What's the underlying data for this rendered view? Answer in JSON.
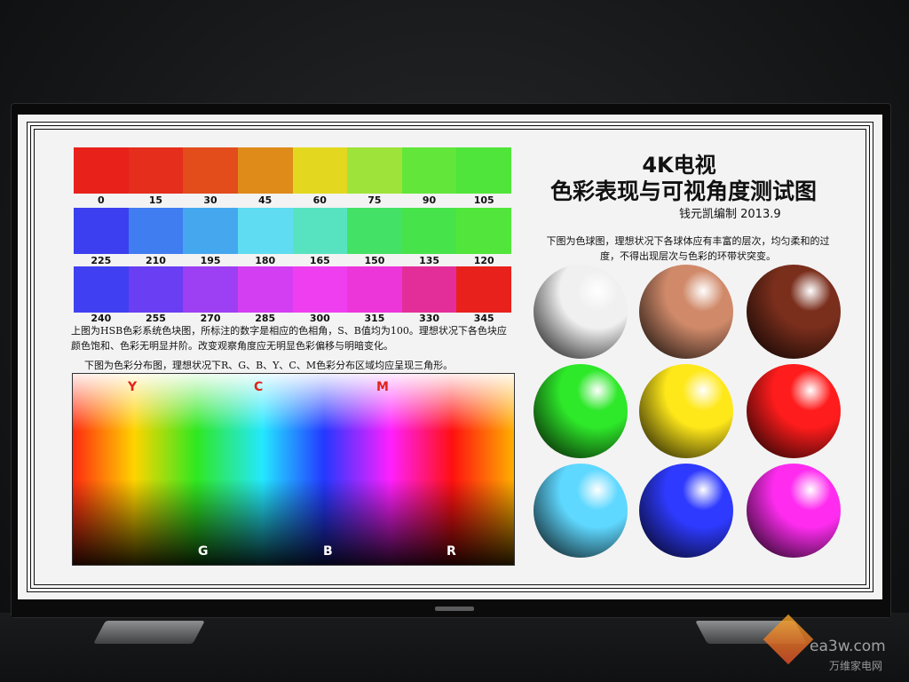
{
  "title_line1": "4K电视",
  "title_line2": "色彩表现与可视角度测试图",
  "author": "钱元凯编制 2013.9",
  "sphere_desc": "下图为色球图，理想状况下各球体应有丰富的层次，均匀柔和的过度，不得出现层次与色彩的环带状突变。",
  "hsb_desc": "上图为HSB色彩系统色块图，所标注的数字是相应的色相角，S、B值均为100。理想状况下各色块应颜色饱和、色彩无明显并阶。改变观察角度应无明显色彩偏移与明暗变化。",
  "dist_desc": "下图为色彩分布图，理想状况下R、G、B、Y、C、M色彩分布区域均应呈现三角形。",
  "row1": {
    "labels": [
      "0",
      "15",
      "30",
      "45",
      "60",
      "75",
      "90",
      "105"
    ],
    "colors": [
      "#e8211a",
      "#e52e1c",
      "#e24d1b",
      "#de8b1a",
      "#e3d81f",
      "#9ee33a",
      "#62e63a",
      "#4fe53a"
    ]
  },
  "row2": {
    "labels": [
      "225",
      "210",
      "195",
      "180",
      "165",
      "150",
      "135",
      "120"
    ],
    "colors": [
      "#3b3ff0",
      "#3f7df1",
      "#45a8ee",
      "#5fdcf1",
      "#58e3c0",
      "#43e266",
      "#47e34a",
      "#52e53c"
    ]
  },
  "row3": {
    "labels": [
      "240",
      "255",
      "270",
      "285",
      "300",
      "315",
      "330",
      "345"
    ],
    "colors": [
      "#4040f2",
      "#6a3ef2",
      "#9d3ff2",
      "#d43ef2",
      "#ef3ef0",
      "#ed36da",
      "#e32e9a",
      "#e8211d"
    ]
  },
  "dist_top_labels": [
    "Y",
    "C",
    "M"
  ],
  "dist_bottom_labels": [
    "G",
    "B",
    "R"
  ],
  "spheres": [
    {
      "name": "gray",
      "color": "#f0f0f0"
    },
    {
      "name": "brown-light",
      "color": "#d08a6a"
    },
    {
      "name": "brown-dark",
      "color": "#7a2e1c"
    },
    {
      "name": "green",
      "color": "#2ee82a"
    },
    {
      "name": "yellow",
      "color": "#ffe81a"
    },
    {
      "name": "red",
      "color": "#ff1c1c"
    },
    {
      "name": "cyan",
      "color": "#5fd8ff"
    },
    {
      "name": "blue",
      "color": "#2e3aff"
    },
    {
      "name": "magenta",
      "color": "#ff2cf0"
    }
  ],
  "watermark_site": "ea3w.com",
  "watermark_cn": "万维家电网"
}
